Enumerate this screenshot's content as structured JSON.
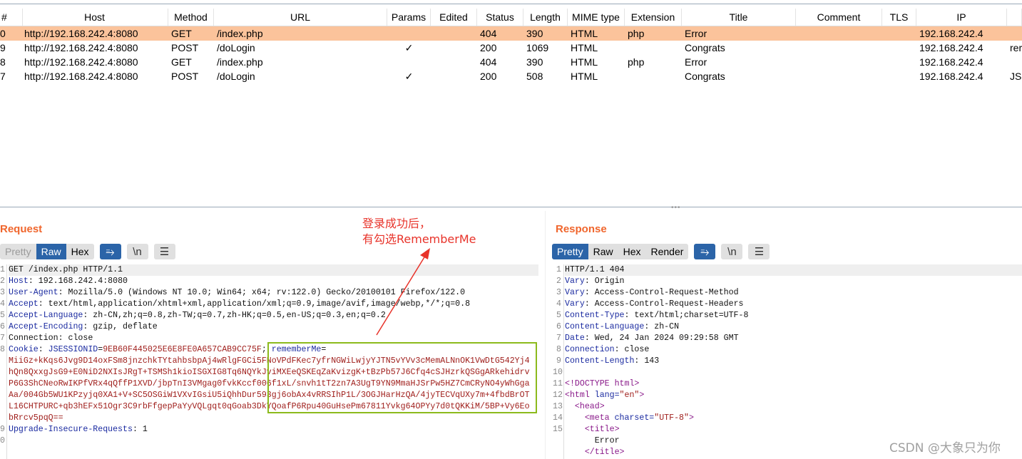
{
  "table": {
    "columns": [
      "#",
      "Host",
      "Method",
      "URL",
      "Params",
      "Edited",
      "Status",
      "Length",
      "MIME type",
      "Extension",
      "Title",
      "Comment",
      "TLS",
      "IP",
      ""
    ],
    "rows": [
      {
        "num": "0",
        "host": "http://192.168.242.4:8080",
        "method": "GET",
        "url": "/index.php",
        "params": "",
        "edited": "",
        "status": "404",
        "length": "390",
        "mime": "HTML",
        "ext": "php",
        "title": "Error",
        "comment": "",
        "tls": "",
        "ip": "192.168.242.4",
        "extra": "",
        "selected": true
      },
      {
        "num": "9",
        "host": "http://192.168.242.4:8080",
        "method": "POST",
        "url": "/doLogin",
        "params": "✓",
        "edited": "",
        "status": "200",
        "length": "1069",
        "mime": "HTML",
        "ext": "",
        "title": "Congrats",
        "comment": "",
        "tls": "",
        "ip": "192.168.242.4",
        "extra": "rer",
        "selected": false
      },
      {
        "num": "8",
        "host": "http://192.168.242.4:8080",
        "method": "GET",
        "url": "/index.php",
        "params": "",
        "edited": "",
        "status": "404",
        "length": "390",
        "mime": "HTML",
        "ext": "php",
        "title": "Error",
        "comment": "",
        "tls": "",
        "ip": "192.168.242.4",
        "extra": "",
        "selected": false
      },
      {
        "num": "7",
        "host": "http://192.168.242.4:8080",
        "method": "POST",
        "url": "/doLogin",
        "params": "✓",
        "edited": "",
        "status": "200",
        "length": "508",
        "mime": "HTML",
        "ext": "",
        "title": "Congrats",
        "comment": "",
        "tls": "",
        "ip": "192.168.242.4",
        "extra": "JSE",
        "selected": false
      }
    ]
  },
  "request": {
    "title": "Request",
    "tabs": [
      "Pretty",
      "Raw",
      "Hex"
    ],
    "active_tab": "Raw",
    "icons": [
      "wrap-icon",
      "newline-icon",
      "menu-icon"
    ],
    "newline_label": "\\n",
    "lines": [
      {
        "n": "1",
        "seg": [
          [
            "v",
            "GET /index.php HTTP/1.1"
          ]
        ]
      },
      {
        "n": "2",
        "seg": [
          [
            "k",
            "Host"
          ],
          [
            "v",
            ": 192.168.242.4:8080"
          ]
        ]
      },
      {
        "n": "3",
        "seg": [
          [
            "k",
            "User-Agent"
          ],
          [
            "v",
            ": Mozilla/5.0 (Windows NT 10.0; Win64; x64; rv:122.0) Gecko/20100101 Firefox/122.0"
          ]
        ]
      },
      {
        "n": "4",
        "seg": [
          [
            "k",
            "Accept"
          ],
          [
            "v",
            ": text/html,application/xhtml+xml,application/xml;q=0.9,image/avif,image/webp,*/*;q=0.8"
          ]
        ]
      },
      {
        "n": "5",
        "seg": [
          [
            "k",
            "Accept-Language"
          ],
          [
            "v",
            ": zh-CN,zh;q=0.8,zh-TW;q=0.7,zh-HK;q=0.5,en-US;q=0.3,en;q=0.2"
          ]
        ]
      },
      {
        "n": "6",
        "seg": [
          [
            "k",
            "Accept-Encoding"
          ],
          [
            "v",
            ": gzip, deflate"
          ]
        ]
      },
      {
        "n": "7",
        "seg": [
          [
            "v",
            "Connection: close"
          ]
        ]
      },
      {
        "n": "8",
        "seg": [
          [
            "k",
            "Cookie"
          ],
          [
            "v",
            ": "
          ],
          [
            "k",
            "JSESSIONID"
          ],
          [
            "v",
            "="
          ],
          [
            "r",
            "9EB60F445025E6E8FE0A657CAB9CC75F"
          ],
          [
            "v",
            "; "
          ],
          [
            "k",
            "rememberMe"
          ],
          [
            "v",
            "="
          ]
        ]
      },
      {
        "n": "",
        "seg": [
          [
            "r",
            "MiiGz+kKqs6Jvg9D14oxFSm8jnzchkTYtahbsbpAj4wRlgFGCi5FNoVPdFKec7yfrNGWiLwjyYJTN5vYVv3cMemALNnOK1VwDtG542Yj4"
          ]
        ]
      },
      {
        "n": "",
        "seg": [
          [
            "r",
            "hQn8QxxgJsG9+E0NiD2NXIsJRgT+TSMSh1kioISGXIG8Tq6NQYkJviMXEeQSKEqZaKvizgK+tBzPb57J6Cfq4cSJHzrkQSGgARkehidrv"
          ]
        ]
      },
      {
        "n": "",
        "seg": [
          [
            "r",
            "P6G3ShCNeoRwIKPfVRx4qQffP1XVD/jbpTnI3VMgag0fvkKccf006f1xL/snvh1tT2zn7A3UgT9YN9MmaHJSrPw5HZ7CmCRyNO4yWhGga"
          ]
        ]
      },
      {
        "n": "",
        "seg": [
          [
            "r",
            "Aa/004Gb5WU1KPzyjq0XA1+V+SC5OSGiW1VXvIGsiU5iQhhDur593gj6obAx4vRRSIhP1L/3OGJHarHzQA/4jyTECVqUXy7m+4fbdBrOT"
          ]
        ]
      },
      {
        "n": "",
        "seg": [
          [
            "r",
            "L16CHTPURC+qb3hEFx51Ogr3C9rbFfgepPaYyVQLgqt0qGoab3DkYQoafP6Rpu40GuHsePm67811Yvkg64OPYy7d0tQKKiM/5BP+Vy6Eo"
          ]
        ]
      },
      {
        "n": "",
        "seg": [
          [
            "r",
            "bRrcv5pqQ=="
          ]
        ]
      },
      {
        "n": "9",
        "seg": [
          [
            "k",
            "Upgrade-Insecure-Requests"
          ],
          [
            "v",
            ": 1"
          ]
        ]
      },
      {
        "n": "0",
        "seg": [
          [
            "v",
            ""
          ]
        ]
      }
    ]
  },
  "response": {
    "title": "Response",
    "tabs": [
      "Pretty",
      "Raw",
      "Hex",
      "Render"
    ],
    "active_tab": "Pretty",
    "icons": [
      "wrap-icon",
      "newline-icon",
      "menu-icon"
    ],
    "newline_label": "\\n",
    "lines": [
      {
        "n": "1",
        "seg": [
          [
            "v",
            "HTTP/1.1 404"
          ]
        ]
      },
      {
        "n": "2",
        "seg": [
          [
            "k",
            "Vary"
          ],
          [
            "v",
            ": Origin"
          ]
        ]
      },
      {
        "n": "3",
        "seg": [
          [
            "k",
            "Vary"
          ],
          [
            "v",
            ": Access-Control-Request-Method"
          ]
        ]
      },
      {
        "n": "4",
        "seg": [
          [
            "k",
            "Vary"
          ],
          [
            "v",
            ": Access-Control-Request-Headers"
          ]
        ]
      },
      {
        "n": "5",
        "seg": [
          [
            "k",
            "Content-Type"
          ],
          [
            "v",
            ": text/html;charset=UTF-8"
          ]
        ]
      },
      {
        "n": "6",
        "seg": [
          [
            "k",
            "Content-Language"
          ],
          [
            "v",
            ": zh-CN"
          ]
        ]
      },
      {
        "n": "7",
        "seg": [
          [
            "k",
            "Date"
          ],
          [
            "v",
            ": Wed, 24 Jan 2024 09:29:58 GMT"
          ]
        ]
      },
      {
        "n": "8",
        "seg": [
          [
            "k",
            "Connection"
          ],
          [
            "v",
            ": close"
          ]
        ]
      },
      {
        "n": "9",
        "seg": [
          [
            "k",
            "Content-Length"
          ],
          [
            "v",
            ": 143"
          ]
        ]
      },
      {
        "n": "10",
        "seg": [
          [
            "v",
            ""
          ]
        ]
      },
      {
        "n": "11",
        "seg": [
          [
            "t",
            "<!DOCTYPE html>"
          ]
        ]
      },
      {
        "n": "12",
        "seg": [
          [
            "t",
            "<html "
          ],
          [
            "k",
            "lang="
          ],
          [
            "s",
            "\"en\""
          ],
          [
            "t",
            ">"
          ]
        ]
      },
      {
        "n": "13",
        "seg": [
          [
            "t",
            "  <head>"
          ]
        ]
      },
      {
        "n": "14",
        "seg": [
          [
            "t",
            "    <meta "
          ],
          [
            "k",
            "charset="
          ],
          [
            "s",
            "\"UTF-8\""
          ],
          [
            "t",
            ">"
          ]
        ]
      },
      {
        "n": "15",
        "seg": [
          [
            "t",
            "    <title>"
          ]
        ]
      },
      {
        "n": "",
        "seg": [
          [
            "v",
            "      Error"
          ]
        ]
      },
      {
        "n": "",
        "seg": [
          [
            "t",
            "    </title>"
          ]
        ]
      }
    ]
  },
  "annotation": {
    "line1": "登录成功后，",
    "line2": "有勾选RememberMe",
    "color": "#e8332a"
  },
  "watermark": "CSDN @大象只为你",
  "colors": {
    "accent": "#f0662d",
    "selected_row": "#fbc39b",
    "active_tab": "#2b64a8",
    "highlight_box": "#8cba1c"
  }
}
